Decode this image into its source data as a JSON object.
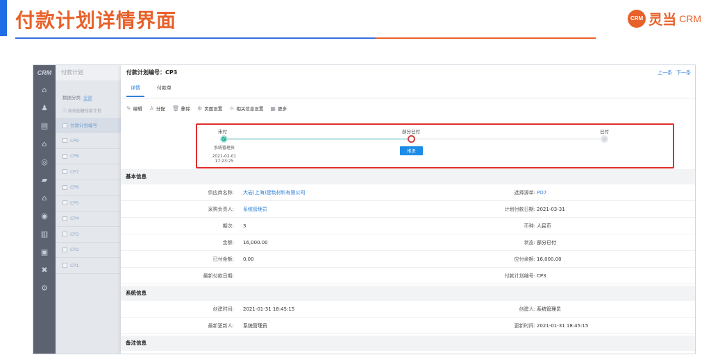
{
  "slide": {
    "title": "付款计划详情界面",
    "brand_logo_text": "CRM",
    "brand_cn": "灵当",
    "brand_en": "CRM",
    "accent_color": "#e8612a",
    "blue_color": "#1f6ee5"
  },
  "nav": {
    "logo": "CRM",
    "icons": [
      "home-icon",
      "user-icon",
      "doc-icon",
      "building-icon",
      "circle-icon",
      "folder-icon",
      "store-icon",
      "shield-icon",
      "chart-icon",
      "report-icon",
      "tools-icon",
      "gear-icon"
    ]
  },
  "list_panel": {
    "title": "付款计划",
    "filter_label": "数据分类",
    "filter_value": "全部",
    "hint": "如何创建付款计划",
    "header": "付款计划编号",
    "rows": [
      "CP9",
      "CP8",
      "CP7",
      "CP6",
      "CP5",
      "CP4",
      "CP3",
      "CP2",
      "CP1"
    ]
  },
  "detail": {
    "title": "付款计划编号：CP3",
    "prev": "上一条",
    "next": "下一条",
    "tabs": [
      "详情",
      "付款单"
    ],
    "toolbar": [
      {
        "icon": "edit-icon",
        "glyph": "✎",
        "label": "编辑"
      },
      {
        "icon": "assign-icon",
        "glyph": "♙",
        "label": "分配"
      },
      {
        "icon": "trash-icon",
        "glyph": "🗑",
        "label": "删除"
      },
      {
        "icon": "page-settings-icon",
        "glyph": "⚙",
        "label": "页面设置"
      },
      {
        "icon": "related-settings-icon",
        "glyph": "☼",
        "label": "相关信息设置"
      },
      {
        "icon": "more-icon",
        "glyph": "▦",
        "label": "更多"
      }
    ]
  },
  "progress": {
    "stages": [
      "未付",
      "部分已付",
      "已付"
    ],
    "stage1_user": "系统管理员",
    "stage1_date": "2021-02-01",
    "stage1_time": "17:23:25",
    "push_button": "推进"
  },
  "basic": {
    "section": "基本信息",
    "rows": [
      {
        "l": "供应商名称:",
        "v": "大岩(上海)建筑材料有限公司",
        "link": true,
        "l2": "选择源单:",
        "v2": "PO7",
        "link2": true
      },
      {
        "l": "采购负责人:",
        "v": "系统管理员",
        "link": true,
        "l2": "计划付款日期:",
        "v2": "2021-03-31",
        "link2": false
      },
      {
        "l": "期次:",
        "v": "3",
        "link": false,
        "l2": "币种:",
        "v2": "人民币",
        "link2": false
      },
      {
        "l": "金额:",
        "v": "16,000.00",
        "link": false,
        "l2": "状态:",
        "v2": "部分已付",
        "link2": false
      },
      {
        "l": "已付金额:",
        "v": "0.00",
        "link": false,
        "l2": "应付余额:",
        "v2": "16,000.00",
        "link2": false
      },
      {
        "l": "最新付款日期:",
        "v": "",
        "link": false,
        "l2": "付款计划编号:",
        "v2": "CP3",
        "link2": false
      }
    ]
  },
  "system": {
    "section": "系统信息",
    "rows": [
      {
        "l": "创建时间:",
        "v": "2021-01-31 18:45:15",
        "link": false,
        "l2": "创建人:",
        "v2": "系统管理员",
        "link2": false
      },
      {
        "l": "最新更新人:",
        "v": "系统管理员",
        "link": false,
        "l2": "更新时间:",
        "v2": "2021-01-31 18:45:15",
        "link2": false
      }
    ]
  },
  "remarks": {
    "section": "备注信息"
  }
}
